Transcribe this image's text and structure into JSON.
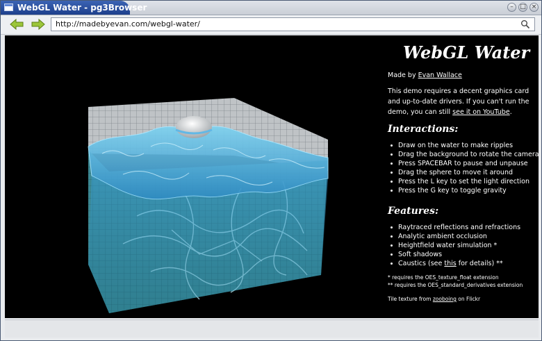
{
  "window": {
    "title": "WebGL Water - pg3Browser"
  },
  "toolbar": {
    "url": "http://madebyevan.com/webgl-water/",
    "back_icon": "arrow-left-icon",
    "forward_icon": "arrow-right-icon",
    "search_icon": "search-icon"
  },
  "page": {
    "title": "WebGL Water",
    "made_by_prefix": "Made by ",
    "made_by_link": "Evan Wallace",
    "intro_text": "This demo requires a decent graphics card and up-to-date drivers. If you can't run the demo, you can still ",
    "intro_link": "see it on YouTube",
    "intro_end": ".",
    "interactions_heading": "Interactions:",
    "interactions": [
      "Draw on the water to make ripples",
      "Drag the background to rotate the camera",
      "Press SPACEBAR to pause and unpause",
      "Drag the sphere to move it around",
      "Press the L key to set the light direction",
      "Press the G key to toggle gravity"
    ],
    "features_heading": "Features:",
    "features": [
      "Raytraced reflections and refractions",
      "Analytic ambient occlusion",
      "Heightfield water simulation *",
      "Soft shadows"
    ],
    "caustics_prefix": "Caustics (see ",
    "caustics_link": "this",
    "caustics_suffix": " for details) **",
    "footnote1": "* requires the OES_texture_float extension",
    "footnote2": "** requires the OES_standard_derivatives extension",
    "tile_prefix": "Tile texture from ",
    "tile_link": "zooboing",
    "tile_suffix": " on Flickr"
  },
  "colors": {
    "titlebar_active": "#2a4fa0",
    "water": "#4fb6e0",
    "pool_tile": "#3f8f9a"
  }
}
